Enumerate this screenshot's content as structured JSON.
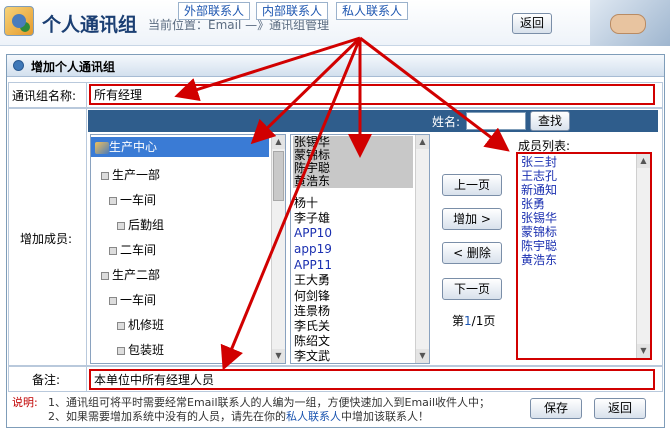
{
  "header": {
    "title": "个人通讯组",
    "breadcrumb": "当前位置：Email —》通讯组管理",
    "back_label": "返回"
  },
  "panel": {
    "title": "增加个人通讯组"
  },
  "form": {
    "group_name_label": "通讯组名称:",
    "group_name_value": "所有经理",
    "add_members_label": "增加成员:",
    "remark_label": "备注:",
    "remark_value": "本单位中所有经理人员"
  },
  "tabs": {
    "external": "外部联系人",
    "internal": "内部联系人",
    "private": "私人联系人",
    "name_label": "姓名:",
    "search_label": "查找"
  },
  "tree": {
    "items": [
      {
        "label": "生产中心",
        "icon": "org-icon",
        "selected": true
      },
      {
        "label": "生产一部"
      },
      {
        "label": "一车间"
      },
      {
        "label": "后勤组"
      },
      {
        "label": "二车间"
      },
      {
        "label": "生产二部"
      },
      {
        "label": "一车间"
      },
      {
        "label": "机修班"
      },
      {
        "label": "包装班"
      }
    ]
  },
  "contacts": {
    "items": [
      {
        "label": "张锡华",
        "highlight": true
      },
      {
        "label": "蒙锦标",
        "highlight": true
      },
      {
        "label": "陈宇聪",
        "highlight": true
      },
      {
        "label": "黄浩东",
        "highlight": true
      },
      {
        "label": "杨十"
      },
      {
        "label": "李子雄"
      },
      {
        "label": "APP10",
        "app": true
      },
      {
        "label": "app19",
        "app": true
      },
      {
        "label": "APP11",
        "app": true
      },
      {
        "label": "王大勇"
      },
      {
        "label": "何剑锋"
      },
      {
        "label": "连景杨"
      },
      {
        "label": "李氏关"
      },
      {
        "label": "陈绍文"
      },
      {
        "label": "李文武"
      }
    ]
  },
  "actions": {
    "prev_page": "上一页",
    "add": "增加 >",
    "delete": "< 删除",
    "next_page": "下一页",
    "page_prefix": "第",
    "page_current": "1",
    "page_sep": "/",
    "page_total": "1",
    "page_suffix": "页"
  },
  "members": {
    "label": "成员列表:",
    "items": [
      "张三封",
      "王志孔",
      "新通知",
      "张勇",
      "张锡华",
      "蒙锦标",
      "陈宇聪",
      "黄浩东"
    ]
  },
  "notes": {
    "label": "说明:",
    "line1": "1、通讯组可将平时需要经常Email联系人的人编为一组，方便快速加入到Email收件人中；",
    "line2_prefix": "2、如果需要增加系统中没有的人员，请先在你的",
    "line2_link": "私人联系人",
    "line2_suffix": "中增加该联系人！"
  },
  "footer": {
    "save_label": "保存",
    "back_label": "返回"
  },
  "colors": {
    "annotation_red": "#d10000",
    "header_text": "#1b3f73",
    "tab_bar": "#2f5d8c",
    "selection": "#3a7bd5"
  }
}
